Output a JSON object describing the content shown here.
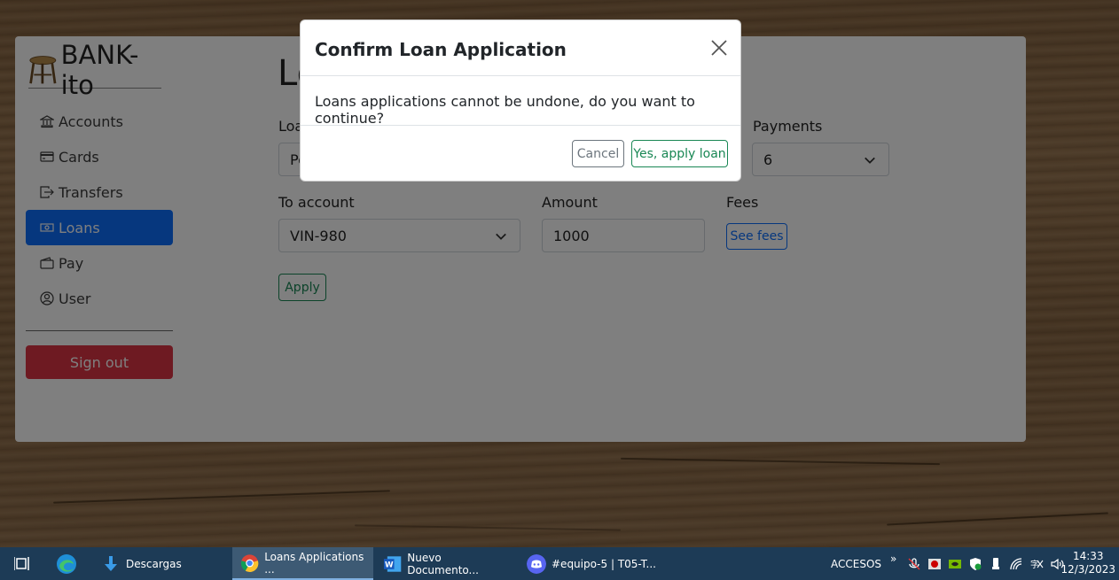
{
  "app": {
    "brand": "BANK-ito",
    "page_title": "Loans",
    "nav": [
      {
        "label": "Accounts",
        "icon": "bank-icon"
      },
      {
        "label": "Cards",
        "icon": "credit-card-icon"
      },
      {
        "label": "Transfers",
        "icon": "box-arrow-right-icon"
      },
      {
        "label": "Loans",
        "icon": "cash-icon",
        "active": true
      },
      {
        "label": "Pay",
        "icon": "wallet-icon"
      },
      {
        "label": "User",
        "icon": "person-circle-icon"
      }
    ],
    "sign_out": "Sign out",
    "form": {
      "loan_label": "Loa",
      "loan_value": "Pe",
      "payments_label": "Payments",
      "payments_value": "6",
      "to_account_label": "To account",
      "to_account_value": "VIN-980",
      "amount_label": "Amount",
      "amount_value": "1000",
      "fees_label": "Fees",
      "see_fees": "See fees",
      "apply": "Apply"
    }
  },
  "modal": {
    "title": "Confirm Loan Application",
    "body": "Loans applications cannot be undone, do you want to continue?",
    "cancel": "Cancel",
    "confirm": "Yes, apply loan"
  },
  "taskbar": {
    "items": [
      {
        "label": "Descargas",
        "icon": "download-arrow-icon"
      },
      {
        "label": "Loans Applications ...",
        "icon": "chrome-icon",
        "active": true
      },
      {
        "label": "Nuevo Documento...",
        "icon": "word-icon"
      },
      {
        "label": "#equipo-5 | T05-T...",
        "icon": "discord-icon"
      }
    ],
    "toolbar_label": "ACCESOS",
    "time": "14:33",
    "date": "12/3/2023"
  },
  "colors": {
    "primary": "#0d6efd",
    "success": "#198754",
    "danger": "#dc3545",
    "taskbar": "#1d3b56"
  }
}
